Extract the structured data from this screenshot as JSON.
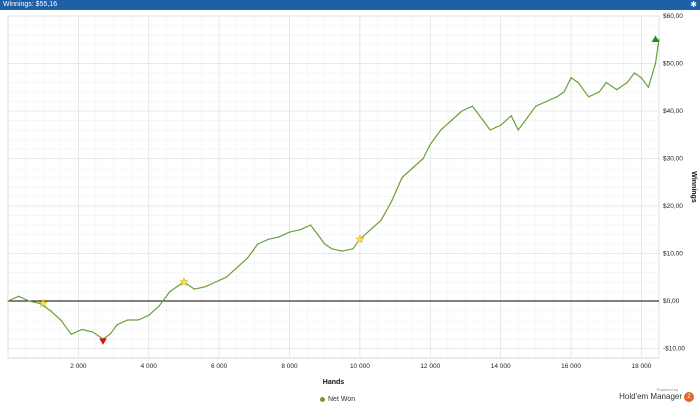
{
  "window": {
    "title": "Winnings: $55,16",
    "pin_icon": "pin-icon"
  },
  "chart_data": {
    "type": "line",
    "xlabel": "Hands",
    "ylabel": "Winnings",
    "xlim": [
      0,
      18500
    ],
    "ylim": [
      -12,
      60
    ],
    "x_ticks": [
      {
        "v": 2000,
        "label": "2 000"
      },
      {
        "v": 4000,
        "label": "4 000"
      },
      {
        "v": 6000,
        "label": "6 000"
      },
      {
        "v": 8000,
        "label": "8 000"
      },
      {
        "v": 10000,
        "label": "10 000"
      },
      {
        "v": 12000,
        "label": "12 000"
      },
      {
        "v": 14000,
        "label": "14 000"
      },
      {
        "v": 16000,
        "label": "16 000"
      },
      {
        "v": 18000,
        "label": "18 000"
      }
    ],
    "y_ticks": [
      {
        "v": 60,
        "label": "$60,00"
      },
      {
        "v": 50,
        "label": "$50,00"
      },
      {
        "v": 40,
        "label": "$40,00"
      },
      {
        "v": 30,
        "label": "$30,00"
      },
      {
        "v": 20,
        "label": "$20,00"
      },
      {
        "v": 10,
        "label": "$10,00"
      },
      {
        "v": 0,
        "label": "$0,00"
      },
      {
        "v": -10,
        "label": "-$10,00"
      }
    ],
    "grid": true,
    "legend_position": "bottom-center",
    "series": [
      {
        "name": "Net Won",
        "color": "#6aa03a",
        "x": [
          0,
          300,
          600,
          900,
          1200,
          1500,
          1800,
          2100,
          2400,
          2700,
          2900,
          3100,
          3400,
          3700,
          4000,
          4300,
          4600,
          4800,
          5000,
          5300,
          5600,
          5900,
          6200,
          6500,
          6800,
          7100,
          7400,
          7700,
          8000,
          8300,
          8600,
          8800,
          9000,
          9200,
          9500,
          9800,
          10000,
          10300,
          10600,
          10900,
          11200,
          11500,
          11800,
          12000,
          12300,
          12600,
          12900,
          13200,
          13500,
          13700,
          14000,
          14300,
          14500,
          14700,
          15000,
          15300,
          15600,
          15800,
          16000,
          16200,
          16500,
          16800,
          17000,
          17300,
          17600,
          17800,
          18000,
          18200,
          18400,
          18500
        ],
        "y": [
          0,
          1,
          0,
          -0.5,
          -2,
          -4,
          -7,
          -6,
          -6.5,
          -8,
          -7,
          -5,
          -4,
          -4,
          -3,
          -1,
          2,
          3,
          4,
          2.5,
          3,
          4,
          5,
          7,
          9,
          12,
          13,
          13.5,
          14.5,
          15,
          16,
          14,
          12,
          11,
          10.5,
          11,
          13,
          15,
          17,
          21,
          26,
          28,
          30,
          33,
          36,
          38,
          40,
          41,
          38,
          36,
          37,
          39,
          36,
          38,
          41,
          42,
          43,
          44,
          47,
          46,
          43,
          44,
          46,
          44.5,
          46,
          48,
          47,
          45,
          50,
          55.16
        ]
      }
    ],
    "markers": [
      {
        "type": "star",
        "x": 1000,
        "y": -0.5
      },
      {
        "type": "triangle-down",
        "x": 2700,
        "y": -8.5
      },
      {
        "type": "star",
        "x": 5000,
        "y": 4
      },
      {
        "type": "star",
        "x": 10000,
        "y": 13
      },
      {
        "type": "triangle-up",
        "x": 18400,
        "y": 55.16
      }
    ]
  },
  "legend": {
    "label": "Net Won"
  },
  "branding": {
    "powered": "Powered by",
    "name": "Hold'em Manager",
    "logo_text": "2"
  }
}
